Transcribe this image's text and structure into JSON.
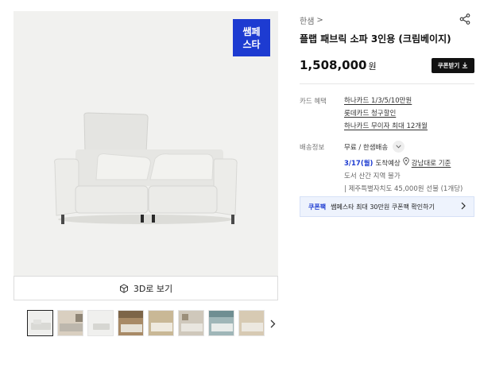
{
  "product_image": {
    "badge": "쌤페\n스타"
  },
  "viewer": {
    "button_3d_label": "3D로 보기"
  },
  "thumbnails": [
    {
      "name": "thumb-1"
    },
    {
      "name": "thumb-2"
    },
    {
      "name": "thumb-3"
    },
    {
      "name": "thumb-4"
    },
    {
      "name": "thumb-5"
    },
    {
      "name": "thumb-6"
    },
    {
      "name": "thumb-7"
    },
    {
      "name": "thumb-8"
    }
  ],
  "info": {
    "brand": "한샘",
    "brand_chevron": ">",
    "title": "플랩 패브릭 소파 3인용 (크림베이지)",
    "price": "1,508,000",
    "price_unit": "원",
    "coupon_button_label": "쿠폰받기",
    "card_benefit_label": "카드 혜택",
    "card_benefits": [
      "하나카드 1/3/5/10만원",
      "롯데카드 청구할인",
      "하나카드 무이자 최대 12개월"
    ],
    "shipping_label": "배송정보",
    "shipping_main": "무료 / 한샘배송",
    "eta_date": "3/17(월)",
    "eta_suffix": "도착예상",
    "eta_location": "강남대로 기준",
    "ship_note_1": "도서 산간 지역 불가",
    "ship_note_2": "| 제주특별자치도 45,000원 선불 (1개당)",
    "coupon_pack_tag": "쿠폰팩",
    "coupon_pack_text": "쌤페스타 최대 30만원 쿠폰팩 확인하기"
  },
  "colors": {
    "badge_bg": "#1d3bd1",
    "accent_blue": "#1d3bd1",
    "coupon_pack_bg": "#eef3fd",
    "coupon_button_bg": "#111111"
  },
  "icons": [
    "share-icon",
    "cube-3d-icon",
    "download-icon",
    "chevron-down-icon",
    "location-pin-icon",
    "chevron-right-icon"
  ]
}
